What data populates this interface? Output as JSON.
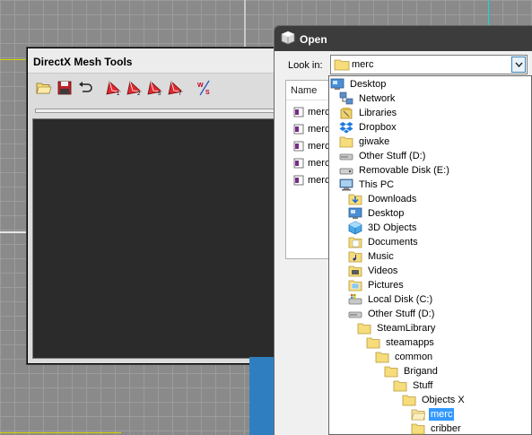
{
  "background_viewport": {
    "grid_color": "#9c9c9c",
    "accent_line_colors": [
      "#d4d400",
      "#00c8c8"
    ]
  },
  "dx_window": {
    "title": "DirectX Mesh Tools",
    "toolbar": [
      {
        "name": "open-folder-icon",
        "badge": ""
      },
      {
        "name": "save-icon",
        "badge": ""
      },
      {
        "name": "undo-icon",
        "badge": ""
      },
      {
        "name": "mesh-tool-icon",
        "badge": "1"
      },
      {
        "name": "mesh-tool-icon",
        "badge": "2"
      },
      {
        "name": "mesh-tool-icon",
        "badge": "5"
      },
      {
        "name": "mesh-tool-icon",
        "badge": "7"
      },
      {
        "name": "ws-tool-icon",
        "badge": "W/S"
      }
    ]
  },
  "open_dialog": {
    "title": "Open",
    "look_in_label": "Look in:",
    "look_in_value": "merc",
    "column_header": "Name",
    "files": [
      "merc",
      "merc",
      "merc",
      "merc",
      "merc"
    ]
  },
  "dropdown": {
    "items": [
      {
        "label": "Desktop",
        "icon": "desktop-icon",
        "level": 0
      },
      {
        "label": "Network",
        "icon": "network-icon",
        "level": 1
      },
      {
        "label": "Libraries",
        "icon": "libraries-icon",
        "level": 1
      },
      {
        "label": "Dropbox",
        "icon": "dropbox-icon",
        "level": 1
      },
      {
        "label": "giwake",
        "icon": "folder-icon",
        "level": 1
      },
      {
        "label": "Other Stuff (D:)",
        "icon": "drive-icon",
        "level": 1
      },
      {
        "label": "Removable Disk (E:)",
        "icon": "removable-drive-icon",
        "level": 1
      },
      {
        "label": "This PC",
        "icon": "computer-icon",
        "level": 1
      },
      {
        "label": "Downloads",
        "icon": "downloads-icon",
        "level": 2
      },
      {
        "label": "Desktop",
        "icon": "desktop-icon",
        "level": 2
      },
      {
        "label": "3D Objects",
        "icon": "3d-objects-icon",
        "level": 2
      },
      {
        "label": "Documents",
        "icon": "documents-icon",
        "level": 2
      },
      {
        "label": "Music",
        "icon": "music-icon",
        "level": 2
      },
      {
        "label": "Videos",
        "icon": "videos-icon",
        "level": 2
      },
      {
        "label": "Pictures",
        "icon": "pictures-icon",
        "level": 2
      },
      {
        "label": "Local Disk (C:)",
        "icon": "system-drive-icon",
        "level": 2
      },
      {
        "label": "Other Stuff (D:)",
        "icon": "drive-icon",
        "level": 2
      },
      {
        "label": "SteamLibrary",
        "icon": "folder-icon",
        "level": 3
      },
      {
        "label": "steamapps",
        "icon": "folder-icon",
        "level": 4
      },
      {
        "label": "common",
        "icon": "folder-icon",
        "level": 5
      },
      {
        "label": "Brigand",
        "icon": "folder-icon",
        "level": 6
      },
      {
        "label": "Stuff",
        "icon": "folder-icon",
        "level": 7
      },
      {
        "label": "Objects X",
        "icon": "folder-icon",
        "level": 8
      },
      {
        "label": "merc",
        "icon": "folder-open-icon",
        "level": 9,
        "selected": true
      },
      {
        "label": "cribber",
        "icon": "folder-icon",
        "level": 9
      }
    ]
  }
}
